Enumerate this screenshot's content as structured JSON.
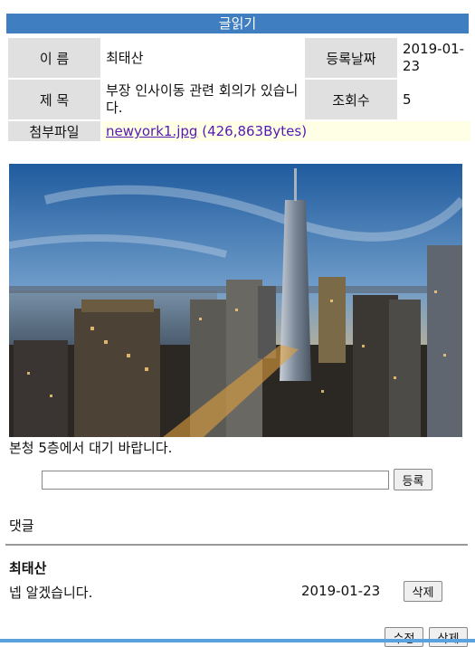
{
  "title": "글읽기",
  "info": {
    "name_label": "이 름",
    "name_value": "최태산",
    "date_label": "등록날짜",
    "date_value": "2019-01-23",
    "subject_label": "제 목",
    "subject_value": "부장 인사이동 관련 회의가 있습니다.",
    "views_label": "조회수",
    "views_value": "5",
    "attach_label": "첨부파일",
    "attach_file": "newyork1.jpg",
    "attach_size": "(426,863Bytes)"
  },
  "body_text": "본청 5층에서 대기 바랍니다.",
  "reply": {
    "input_value": "",
    "submit_label": "등록"
  },
  "comments": {
    "heading": "댓글",
    "items": [
      {
        "author": "최태산",
        "text": "넵 알겠습니다.",
        "date": "2019-01-23",
        "delete_label": "삭제"
      }
    ]
  },
  "actions": {
    "edit_label": "수정",
    "delete_label": "삭제"
  },
  "colors": {
    "title_bar": "#3f7fc1",
    "label_bg": "#e0e0e0",
    "attach_bg": "#ffffe6",
    "link": "#551ab2"
  }
}
